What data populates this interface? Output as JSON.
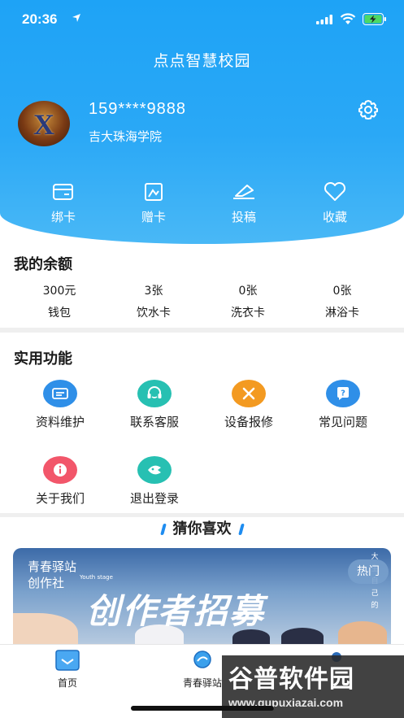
{
  "status": {
    "time": "20:36"
  },
  "header": {
    "title": "点点智慧校园"
  },
  "profile": {
    "phone": "159****9888",
    "school": "吉大珠海学院",
    "avatar_letter": "X"
  },
  "quick_actions": [
    {
      "label": "绑卡",
      "icon": "card-icon"
    },
    {
      "label": "赠卡",
      "icon": "gift-card-icon"
    },
    {
      "label": "投稿",
      "icon": "submit-icon"
    },
    {
      "label": "收藏",
      "icon": "heart-icon"
    }
  ],
  "balance": {
    "title": "我的余额",
    "items": [
      {
        "value": "300元",
        "name": "钱包"
      },
      {
        "value": "3张",
        "name": "饮水卡"
      },
      {
        "value": "0张",
        "name": "洗衣卡"
      },
      {
        "value": "0张",
        "name": "淋浴卡"
      }
    ]
  },
  "functions": {
    "title": "实用功能",
    "items": [
      {
        "label": "资料维护",
        "icon": "profile-edit-icon",
        "color": "#2f8fe8"
      },
      {
        "label": "联系客服",
        "icon": "headset-icon",
        "color": "#27c0b2"
      },
      {
        "label": "设备报修",
        "icon": "tools-icon",
        "color": "#f39a21"
      },
      {
        "label": "常见问题",
        "icon": "question-icon",
        "color": "#2f8fe8"
      },
      {
        "label": "关于我们",
        "icon": "info-icon",
        "color": "#f2566a"
      },
      {
        "label": "退出登录",
        "icon": "logout-icon",
        "color": "#27c0b2"
      }
    ]
  },
  "recommend": {
    "title": "猜你喜欢",
    "banner": {
      "line1": "青春驿站",
      "line2": "创作社",
      "youth": "Youth stage",
      "main": "创作者招募",
      "side": "大 生 自 己 的",
      "hot": "热门"
    }
  },
  "tabbar": {
    "items": [
      {
        "label": "首页",
        "icon": "home-icon"
      },
      {
        "label": "青春驿站",
        "icon": "youth-station-icon"
      },
      {
        "label": "",
        "icon": "profile-icon"
      }
    ]
  },
  "watermark": {
    "text": "谷普软件园",
    "url": "www.gupuxiazai.com"
  },
  "colors": {
    "primary": "#1ea3f6",
    "accent_blue": "#2f8fe8",
    "accent_teal": "#27c0b2",
    "accent_orange": "#f39a21",
    "accent_red": "#f2566a"
  }
}
